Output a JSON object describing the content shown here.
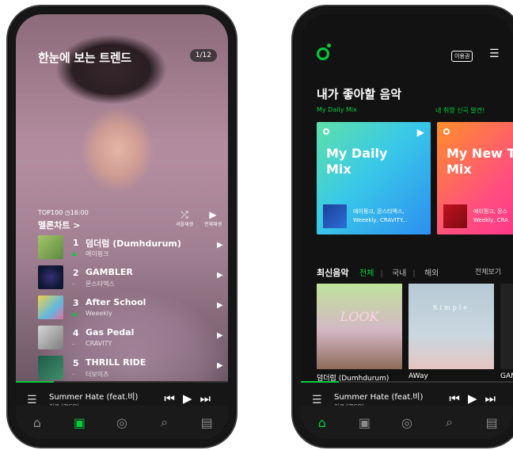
{
  "left_screen": {
    "title": "한눈에 보는 트렌드",
    "page_indicator": "1/12",
    "chart_meta": "TOP100 ◷16:00",
    "chart_link": "멜론차트 >",
    "shuffle_label": "셔플재생",
    "play_all_label": "전체재생",
    "rows": [
      {
        "rank": "1",
        "trend": "▲",
        "song": "덤더럼 (Dumhdurum)",
        "artist": "에이핑크",
        "thumb_color": "#7fa65a"
      },
      {
        "rank": "2",
        "trend": "–",
        "song": "GAMBLER",
        "artist": "몬스타엑스",
        "thumb_color": "#1a2b4a"
      },
      {
        "rank": "3",
        "trend": "▲",
        "song": "After School",
        "artist": "Weeekly",
        "thumb_color": "#6bb6d8"
      },
      {
        "rank": "4",
        "trend": "–",
        "song": "Gas Pedal",
        "artist": "CRAVITY",
        "thumb_color": "#9a9a9a"
      },
      {
        "rank": "5",
        "trend": "–",
        "song": "THRILL RIDE",
        "artist": "더보이즈",
        "thumb_color": "#2f6a5a"
      }
    ],
    "player": {
      "title": "Summer Hate (feat.비)",
      "artist": "지코 (ZICO)"
    }
  },
  "right_screen": {
    "pass_label": "이용권",
    "heading": "내가 좋아할 음악",
    "sub_left": "My Daily Mix",
    "sub_right": "내 취향 신곡 발견!",
    "cards": [
      {
        "title_l1": "My Daily",
        "title_l2": "Mix",
        "artists": "에이핑크, 몬스타엑스,",
        "artists2": "Weeekly, CRAVITY..."
      },
      {
        "title_l1": "My New Tr",
        "title_l2": "Mix",
        "artists": "에이핑크, 몬스",
        "artists2": "Weekly, CRA"
      }
    ],
    "new_heading": "최신음악",
    "tabs": [
      "전체",
      "국내",
      "해외"
    ],
    "see_all": "전체보기",
    "albums": [
      {
        "art_text": "LOOK",
        "name": "덤더럼 (Dumhdurum)"
      },
      {
        "art_text": "Simple",
        "name": "AWay"
      },
      {
        "art_text": "",
        "name": "GAM"
      }
    ],
    "player": {
      "title": "Summer Hate (feat.비)",
      "artist": "지코 (ZICO)"
    }
  },
  "colors": {
    "accent": "#00cd3c",
    "background": "#121212"
  },
  "icons": {
    "nav": [
      "home-icon",
      "music-note-icon",
      "podcast-icon",
      "search-icon",
      "library-icon"
    ],
    "player": [
      "playlist-icon",
      "previous-icon",
      "play-icon",
      "next-icon"
    ]
  }
}
